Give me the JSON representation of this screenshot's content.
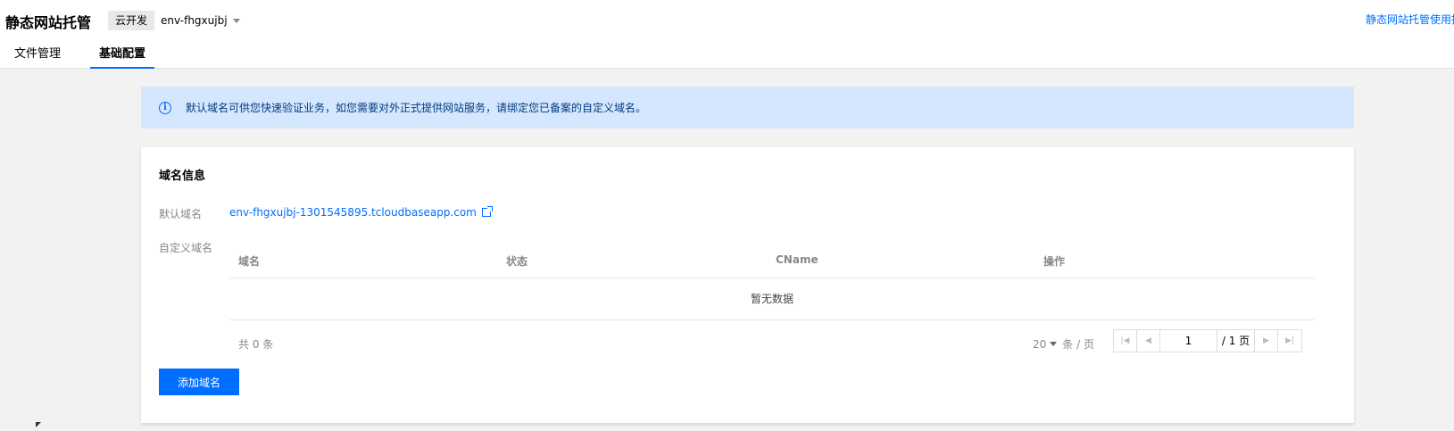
{
  "header": {
    "title": "静态网站托管",
    "env_tag": "云开发",
    "env_name": "env-fhgxujbj",
    "help_link": "静态网站托管使用指"
  },
  "tabs": [
    {
      "label": "文件管理",
      "active": false
    },
    {
      "label": "基础配置",
      "active": true
    }
  ],
  "notice": {
    "text": "默认域名可供您快速验证业务，如您需要对外正式提供网站服务，请绑定您已备案的自定义域名。"
  },
  "domain_card": {
    "title": "域名信息",
    "default_label": "默认域名",
    "default_domain": "env-fhgxujbj-1301545895.tcloudbaseapp.com",
    "custom_label": "自定义域名",
    "table": {
      "columns": [
        "域名",
        "状态",
        "CName",
        "操作"
      ],
      "empty_text": "暂无数据"
    },
    "pager": {
      "total_text": "共 0 条",
      "page_size": "20",
      "page_size_unit": "条 / 页",
      "current_page": "1",
      "total_pages": "/ 1 页"
    },
    "add_button": "添加域名"
  },
  "colors": {
    "accent": "#006eff",
    "notice_bg": "#d5e7ff",
    "page_bg": "#f2f2f2"
  }
}
